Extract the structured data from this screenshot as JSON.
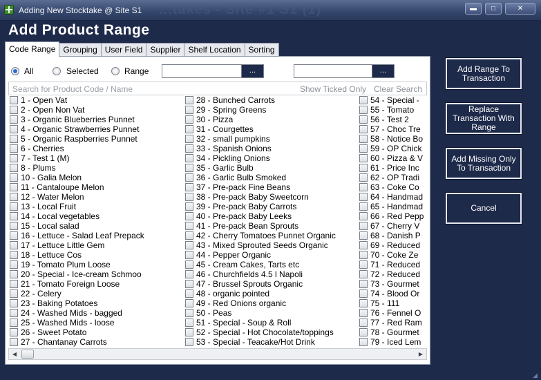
{
  "window": {
    "title": "Adding New Stocktake @ Site S1",
    "background_title": "...takes - Site #1 S1 (1)",
    "minimize_glyph": "▬",
    "maximize_glyph": "□",
    "close_glyph": "✕"
  },
  "heading": "Add Product Range",
  "tabs": [
    "Code Range",
    "Grouping",
    "User Field",
    "Supplier",
    "Shelf Location",
    "Sorting"
  ],
  "filter": {
    "options": [
      "All",
      "Selected",
      "Range"
    ],
    "selected": "All",
    "range_from": "",
    "range_to": "",
    "browse_label": "..."
  },
  "search": {
    "placeholder": "Search for Product Code / Name",
    "show_ticked_label": "Show Ticked Only",
    "clear_label": "Clear Search"
  },
  "products": {
    "column1": [
      "1 - Open Vat",
      "2 - Open Non Vat",
      "3 - Organic Blueberries Punnet",
      "4 - Organic Strawberries Punnet",
      "5 - Organic Raspberries Punnet",
      "6 - Cherries",
      "7 - Test 1 (M)",
      "8 - Plums",
      "10 - Galia Melon",
      "11 - Cantaloupe Melon",
      "12 - Water Melon",
      "13 - Local Fruit",
      "14 - Local vegetables",
      "15 - Local salad",
      "16 - Lettuce - Salad Leaf Prepack",
      "17 - Lettuce Little Gem",
      "18 - Lettuce Cos",
      "19 - Tomato Plum Loose",
      "20 - Special - Ice-cream Schmoo",
      "21 - Tomato Foreign  Loose",
      "22 - Celery",
      "23 - Baking Potatoes",
      "24 - Washed Mids - bagged",
      "25 - Washed Mids - loose",
      "26 - Sweet Potato",
      "27 - Chantanay Carrots"
    ],
    "column2": [
      "28 - Bunched  Carrots",
      "29 - Spring Greens",
      "30 - Pizza",
      "31 - Courgettes",
      "32 - small pumpkins",
      "33 - Spanish Onions",
      "34 - Pickling Onions",
      "35 - Garlic  Bulb",
      "36 - Garlic  Bulb Smoked",
      "37 - Pre-pack Fine Beans",
      "38 - Pre-pack Baby Sweetcorn",
      "39 - Pre-pack Baby Carrots",
      "40 - Pre-pack Baby Leeks",
      "41 - Pre-pack Bean Sprouts",
      "42 - Cherry Tomatoes Punnet Organic",
      "43 - Mixed Sprouted Seeds Organic",
      "44 - Pepper Organic",
      "45 - Cream Cakes,  Tarts etc",
      "46 - Churchfields 4.5 l Napoli",
      "47 - Brussel Sprouts Organic",
      "48 - organic pointed",
      "49 - Red Onions organic",
      "50 - Peas",
      "51 - Special - Soup & Roll",
      "52 - Special - Hot Chocolate/toppings",
      "53 - Special - Teacake/Hot Drink"
    ],
    "column3": [
      "54 - Special -",
      "55 - Tomato",
      "56 - Test 2",
      "57 - Choc Tre",
      "58 - Notice Bo",
      "59 - OP Chick",
      "60 - Pizza & V",
      "61 - Price Inc",
      "62 - OP Tradi",
      "63 - Coke Co",
      "64 - Handmad",
      "65 - Handmad",
      "66 - Red Pepp",
      "67 - Cherry V",
      "68 - Danish P",
      "69 - Reduced",
      "70 - Coke Ze",
      "71 - Reduced",
      "72 - Reduced",
      "73 - Gourmet",
      "74 - Blood Or",
      "75 - 111",
      "76 - Fennel O",
      "77 - Red Ram",
      "78 - Gourmet",
      "79 - Iced Lem"
    ]
  },
  "scrollbar": {
    "left_arrow": "◀",
    "right_arrow": "▶"
  },
  "actions": {
    "add_range": "Add Range To Transaction",
    "replace": "Replace Transaction With Range",
    "add_missing": "Add Missing Only To Transaction",
    "cancel": "Cancel"
  }
}
